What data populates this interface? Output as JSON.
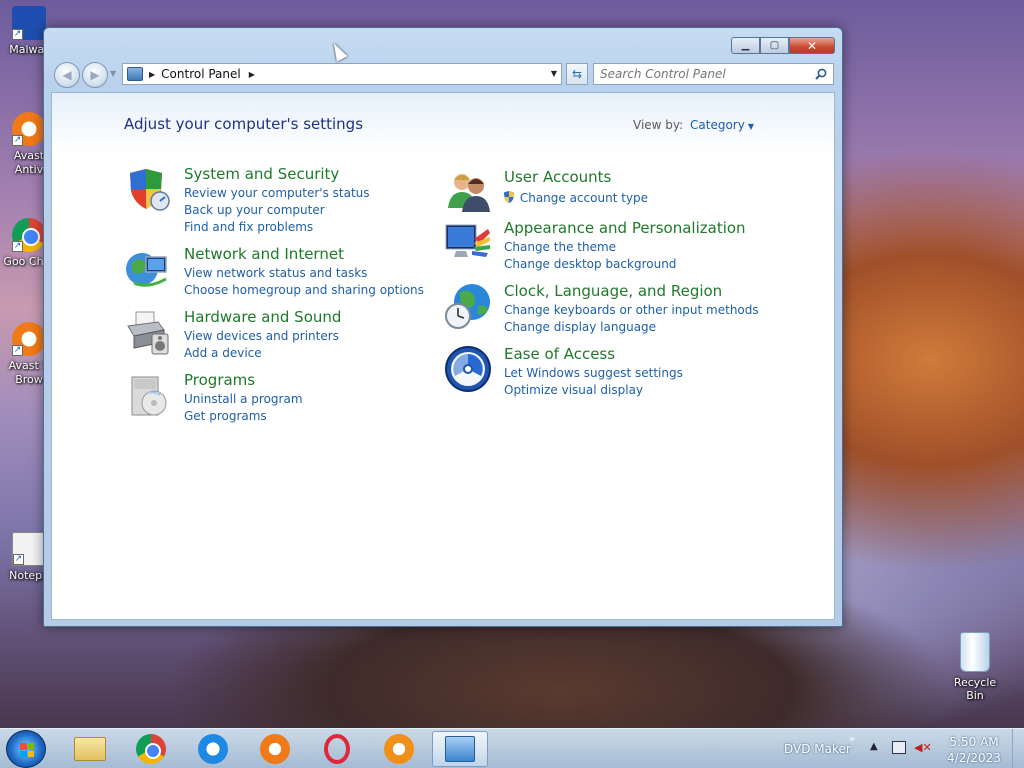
{
  "desktop": {
    "icons": [
      {
        "label": "Malwar",
        "icon": "malwarebytes-icon"
      },
      {
        "label": "Avast Antiv",
        "icon": "avast-antivirus-icon"
      },
      {
        "label": "Goo Chro",
        "icon": "google-chrome-icon"
      },
      {
        "label": "Avast S Brow",
        "icon": "avast-secure-browser-icon"
      },
      {
        "label": "Notepa",
        "icon": "notepad-icon"
      }
    ],
    "recycle_bin": "Recycle Bin"
  },
  "window": {
    "controls": {
      "minimize": "▁",
      "maximize": "▢",
      "close": "✕"
    },
    "address": {
      "root_icon": "control-panel-icon",
      "crumbs": [
        "Control Panel"
      ]
    },
    "search": {
      "placeholder": "Search Control Panel"
    },
    "heading": "Adjust your computer's settings",
    "view_by": {
      "label": "View by:",
      "value": "Category"
    },
    "categories": [
      {
        "title": "System and Security",
        "icon": "shield-icon",
        "links": [
          "Review your computer's status",
          "Back up your computer",
          "Find and fix problems"
        ]
      },
      {
        "title": "Network and Internet",
        "icon": "network-globe-icon",
        "links": [
          "View network status and tasks",
          "Choose homegroup and sharing options"
        ]
      },
      {
        "title": "Hardware and Sound",
        "icon": "printer-icon",
        "links": [
          "View devices and printers",
          "Add a device"
        ]
      },
      {
        "title": "Programs",
        "icon": "programs-icon",
        "links": [
          "Uninstall a program",
          "Get programs"
        ]
      },
      {
        "title": "User Accounts",
        "icon": "users-icon",
        "links": [
          "Change account type"
        ]
      },
      {
        "title": "Appearance and Personalization",
        "icon": "display-palette-icon",
        "links": [
          "Change the theme",
          "Change desktop background"
        ]
      },
      {
        "title": "Clock, Language, and Region",
        "icon": "clock-globe-icon",
        "links": [
          "Change keyboards or other input methods",
          "Change display language"
        ]
      },
      {
        "title": "Ease of Access",
        "icon": "ease-of-access-icon",
        "links": [
          "Let Windows suggest settings",
          "Optimize visual display"
        ]
      }
    ]
  },
  "taskbar": {
    "apps": [
      "file-explorer-icon",
      "chrome-icon",
      "internet-explorer-icon",
      "avast-icon",
      "opera-icon",
      "avast-browser-icon",
      "control-panel-icon"
    ],
    "tray_label": "DVD Maker",
    "time": "5:50 AM",
    "date": "4/2/2023"
  },
  "colors": {
    "title_green": "#1e7a2a",
    "link_blue": "#1e5fa8",
    "heading_blue": "#1e3287"
  }
}
